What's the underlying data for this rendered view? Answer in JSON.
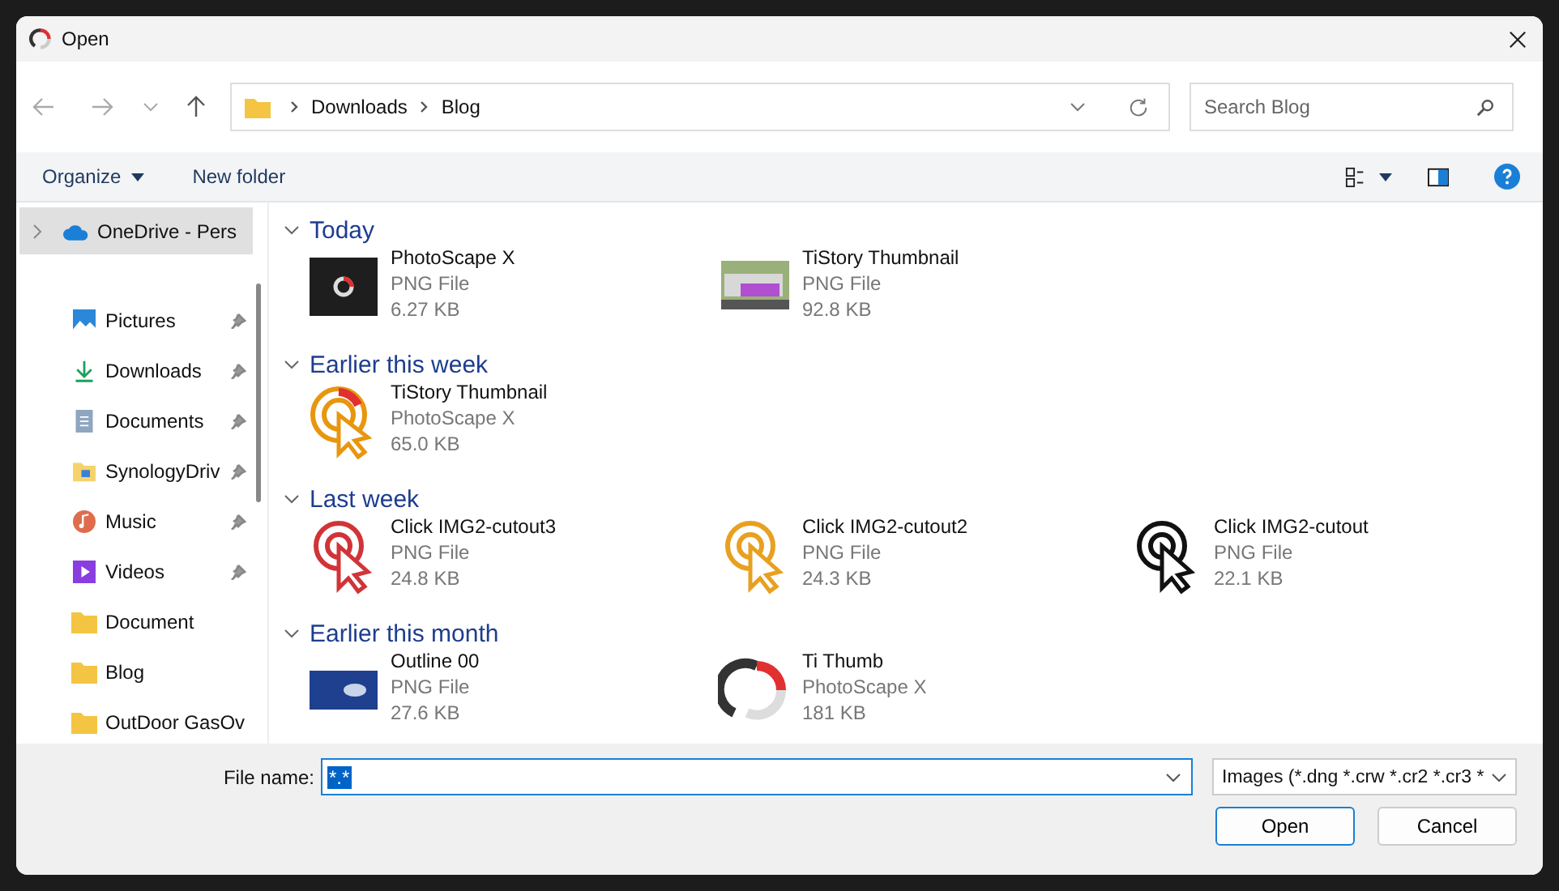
{
  "window": {
    "title": "Open"
  },
  "address": {
    "crumbs": [
      "Downloads",
      "Blog"
    ]
  },
  "search": {
    "placeholder": "Search Blog"
  },
  "toolbar": {
    "organize": "Organize",
    "new_folder": "New folder"
  },
  "sidebar": {
    "items": [
      {
        "label": "OneDrive - Pers",
        "kind": "cloud",
        "pinned": false,
        "selected": true
      },
      {
        "label": "Pictures",
        "kind": "pictures",
        "pinned": true,
        "selected": false
      },
      {
        "label": "Downloads",
        "kind": "downloads",
        "pinned": true,
        "selected": false
      },
      {
        "label": "Documents",
        "kind": "documents",
        "pinned": true,
        "selected": false
      },
      {
        "label": "SynologyDriv",
        "kind": "synology",
        "pinned": true,
        "selected": false
      },
      {
        "label": "Music",
        "kind": "music",
        "pinned": true,
        "selected": false
      },
      {
        "label": "Videos",
        "kind": "videos",
        "pinned": true,
        "selected": false
      },
      {
        "label": "Document",
        "kind": "folder",
        "pinned": false,
        "selected": false
      },
      {
        "label": "Blog",
        "kind": "folder",
        "pinned": false,
        "selected": false
      },
      {
        "label": "OutDoor GasOv",
        "kind": "folder",
        "pinned": false,
        "selected": false
      }
    ]
  },
  "groups": [
    {
      "title": "Today",
      "expanded": true,
      "files": [
        {
          "name": "PhotoScape X",
          "type": "PNG File",
          "size": "6.27 KB",
          "kind": "dark-logo"
        },
        {
          "name": "TiStory Thumbnail",
          "type": "PNG File",
          "size": "92.8 KB",
          "kind": "bus-photo"
        }
      ]
    },
    {
      "title": "Earlier this week",
      "expanded": true,
      "files": [
        {
          "name": "TiStory Thumbnail",
          "type": "PhotoScape X",
          "size": "65.0 KB",
          "kind": "logo-cursor"
        }
      ]
    },
    {
      "title": "Last week",
      "expanded": true,
      "files": [
        {
          "name": "Click IMG2-cutout3",
          "type": "PNG File",
          "size": "24.8 KB",
          "kind": "cursor",
          "color": "#d13438"
        },
        {
          "name": "Click IMG2-cutout2",
          "type": "PNG File",
          "size": "24.3 KB",
          "kind": "cursor",
          "color": "#e8a020"
        },
        {
          "name": "Click IMG2-cutout",
          "type": "PNG File",
          "size": "22.1 KB",
          "kind": "cursor",
          "color": "#111111"
        }
      ]
    },
    {
      "title": "Earlier this month",
      "expanded": true,
      "files": [
        {
          "name": "Outline 00",
          "type": "PNG File",
          "size": "27.6 KB",
          "kind": "blue-photo"
        },
        {
          "name": "Ti Thumb",
          "type": "PhotoScape X",
          "size": "181 KB",
          "kind": "logo"
        }
      ]
    }
  ],
  "file_name": {
    "label": "File name:",
    "value": "*.*"
  },
  "file_type": {
    "value": "Images (*.dng *.crw *.cr2 *.cr3 *"
  },
  "buttons": [
    {
      "label": "Open",
      "kind": "primary"
    },
    {
      "label": "Cancel",
      "kind": "secondary"
    }
  ]
}
